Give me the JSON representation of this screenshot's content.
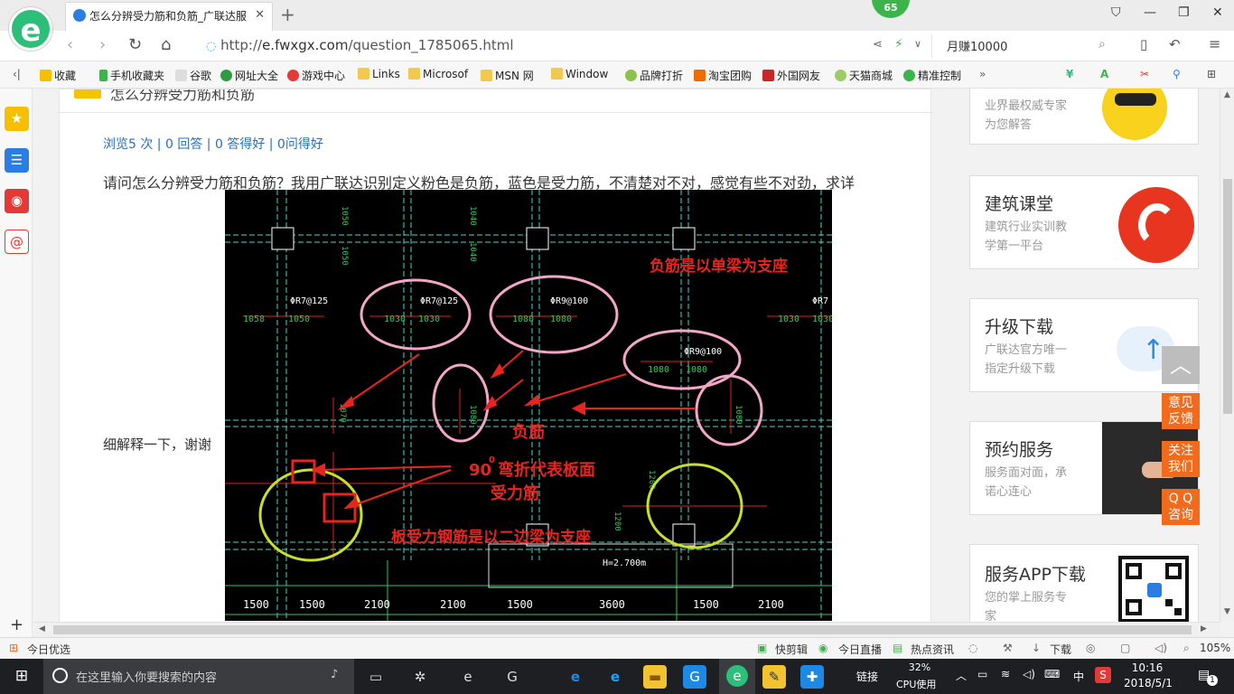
{
  "browser": {
    "tab_title": "怎么分辨受力筋和负筋_广联达服",
    "badge_value": "65",
    "url_prefix": "http://",
    "url_host": "e.fwxgx.com",
    "url_path": "/question_1785065.html",
    "search_text": "月赚10000"
  },
  "bookmarks": [
    "收藏",
    "手机收藏夹",
    "谷歌",
    "网址大全",
    "游戏中心",
    "Links",
    "Microsof",
    "MSN 网",
    "Window",
    "品牌打折",
    "淘宝团购",
    "外国网友",
    "天猫商城",
    "精准控制"
  ],
  "article": {
    "top_title": "怎么分辨受力筋和负筋",
    "stats": "浏览5 次 | 0 回答 | 0 答得好 | 0问得好",
    "question_line1": "请问怎么分辨受力筋和负筋？我用广联达识别定义粉色是负筋，蓝色是受力筋，不清楚对不对，感觉有些不对劲，求详",
    "question_line2": "细解释一下，谢谢",
    "cad_annotations": {
      "top_note": "负筋是以单梁为支座",
      "fujin": "负筋",
      "bend_note_1": "90",
      "bend_note_sup": "0",
      "bend_note_2": "弯折代表板面",
      "bend_note_3": "受力筋",
      "bottom_note": "板受力钢筋是以二边梁为支座",
      "rebar_labels": [
        "ΦR7@125",
        "ΦR7@125",
        "ΦR9@100",
        "ΦR9@100",
        "ΦR7"
      ],
      "dims_top": [
        "1058",
        "1050",
        "1030",
        "1030",
        "1080",
        "1080",
        "1030",
        "1030"
      ],
      "dims_mid": [
        "1080",
        "1080"
      ],
      "dims_vertical": [
        "1050",
        "1040",
        "1050",
        "1040",
        "1070",
        "1080",
        "1080",
        "1200",
        "1200"
      ],
      "elevation": "H=2.700m",
      "bottom_dims": [
        "1500",
        "1500",
        "2100",
        "2100",
        "1500",
        "3600",
        "1500",
        "2100"
      ]
    }
  },
  "right_cards": [
    {
      "title": "",
      "line1": "业界最权威专家",
      "line2": "为您解答"
    },
    {
      "title": "建筑课堂",
      "line1": "建筑行业实训教",
      "line2": "学第一平台"
    },
    {
      "title": "升级下载",
      "line1": "广联达官方唯一",
      "line2": "指定升级下载"
    },
    {
      "title": "预约服务",
      "line1": "服务面对面，承",
      "line2": "诺心连心"
    },
    {
      "title": "服务APP下载",
      "line1": "您的掌上服务专",
      "line2": "家"
    }
  ],
  "float_buttons": [
    {
      "l1": "意见",
      "l2": "反馈"
    },
    {
      "l1": "关注",
      "l2": "我们"
    },
    {
      "l1": "Q Q",
      "l2": "咨询"
    }
  ],
  "statusbar": {
    "left": "今日优选",
    "items": [
      "快剪辑",
      "今日直播",
      "热点资讯",
      "下载"
    ],
    "zoom": "105%"
  },
  "taskbar": {
    "search_placeholder": "在这里输入你要搜索的内容",
    "link_label": "链接",
    "cpu_percent": "32%",
    "cpu_label": "CPU使用",
    "ime": "中",
    "time": "10:16",
    "date": "2018/5/1",
    "notif_count": "1"
  },
  "colors": {
    "accent_green": "#2cbf7a",
    "link_blue": "#2a6fb8",
    "annotation_red": "#e8241e",
    "float_orange": "#f26b1d"
  }
}
